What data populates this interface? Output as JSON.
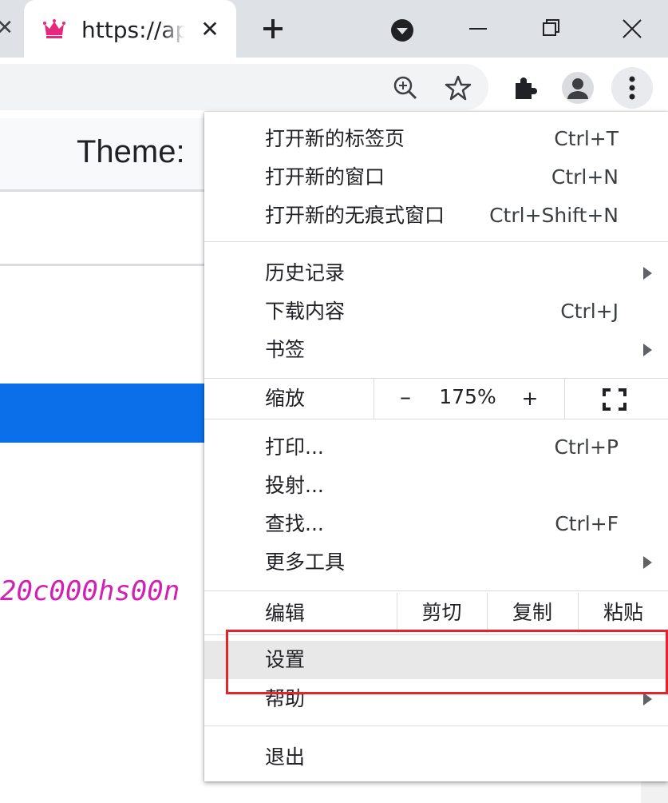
{
  "browser": {
    "tab": {
      "title": "https://api.",
      "favicon_color": "#e6287f",
      "close_glyph": "✕"
    },
    "prev_tab_close_glyph": "✕",
    "window_controls": [
      "minimize-icon",
      "maximize-icon",
      "close-icon"
    ]
  },
  "page": {
    "theme_label": "Theme:",
    "code_text": "20c000hs00n",
    "blue_bar_color": "#0a6fe8",
    "code_color": "#d21fb4"
  },
  "menu": {
    "new_tab": {
      "label": "打开新的标签页",
      "shortcut": "Ctrl+T"
    },
    "new_window": {
      "label": "打开新的窗口",
      "shortcut": "Ctrl+N"
    },
    "new_incognito": {
      "label": "打开新的无痕式窗口",
      "shortcut": "Ctrl+Shift+N"
    },
    "history": {
      "label": "历史记录"
    },
    "downloads": {
      "label": "下载内容",
      "shortcut": "Ctrl+J"
    },
    "bookmarks": {
      "label": "书签"
    },
    "zoom": {
      "label": "缩放",
      "minus": "–",
      "value": "175%",
      "plus": "+"
    },
    "print": {
      "label": "打印...",
      "shortcut": "Ctrl+P"
    },
    "cast": {
      "label": "投射..."
    },
    "find": {
      "label": "查找...",
      "shortcut": "Ctrl+F"
    },
    "more_tools": {
      "label": "更多工具"
    },
    "edit": {
      "label": "编辑",
      "cut": "剪切",
      "copy": "复制",
      "paste": "粘贴"
    },
    "settings": {
      "label": "设置"
    },
    "help": {
      "label": "帮助"
    },
    "exit": {
      "label": "退出"
    }
  },
  "annotation": {
    "highlight_color": "#e4232a",
    "highlighted_item": "设置"
  }
}
